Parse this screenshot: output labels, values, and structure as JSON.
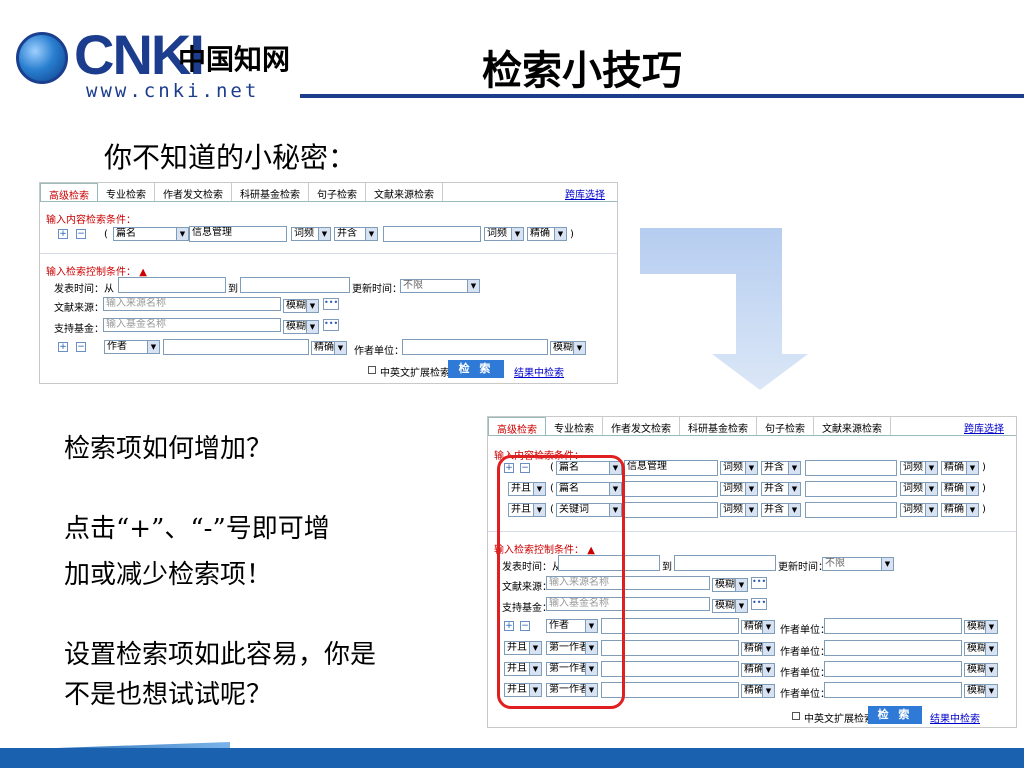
{
  "logo": {
    "brand": "CNKI",
    "cn": "中国知网",
    "url": "www.cnki.net"
  },
  "title": "检索小技巧",
  "subtitle": "你不知道的小秘密：",
  "tabs": [
    "高级检索",
    "专业检索",
    "作者发文检索",
    "科研基金检索",
    "句子检索",
    "文献来源检索"
  ],
  "lib_select": "跨库选择",
  "section_input": "输入内容检索条件：",
  "section_control": "输入检索控制条件：",
  "field_title": "篇名",
  "field_keyword": "关键词",
  "search_value": "信息管理",
  "freq": "词频",
  "and_contains": "并含",
  "exact": "精确",
  "fuzzy": "模糊",
  "and": "并且",
  "publish_time": "发表时间：",
  "from": "从",
  "to": "到",
  "update_time": "更新时间：",
  "unlimited": "不限",
  "source": "文献来源：",
  "source_ph": "输入来源名称",
  "fund": "支持基金：",
  "fund_ph": "输入基金名称",
  "author": "作者",
  "first_author": "第一作者",
  "author_unit": "作者单位：",
  "cross_lang": "中英文扩展检索",
  "search_btn": "检 索",
  "result_search": "结果中检索",
  "q1": "检索项如何增加？",
  "a1_line1": "点击“+”、“-”号即可增",
  "a1_line2": "加或减少检索项！",
  "q2_line1": "设置检索项如此容易，你是",
  "q2_line2": "不是也想试试呢？",
  "colors": {
    "brand": "#1c3c8e",
    "highlight": "#e02020",
    "arrow": "#aac8ee"
  }
}
